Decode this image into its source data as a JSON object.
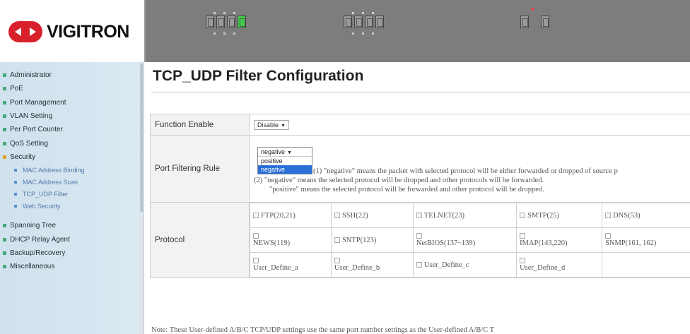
{
  "brand": {
    "name": "VIGITRON",
    "color": "#d8202a"
  },
  "sidebar": {
    "items": [
      {
        "label": "Administrator"
      },
      {
        "label": "PoE"
      },
      {
        "label": "Port Management"
      },
      {
        "label": "VLAN Setting"
      },
      {
        "label": "Per Port Counter"
      },
      {
        "label": "QoS Setting"
      },
      {
        "label": "Security",
        "active": true
      }
    ],
    "security_sub": [
      {
        "label": "MAC Address Binding"
      },
      {
        "label": "MAC Address Scan"
      },
      {
        "label": "TCP_UDP Filter"
      },
      {
        "label": "Web Security"
      }
    ],
    "items_after": [
      {
        "label": "Spanning Tree"
      },
      {
        "label": "DHCP Relay Agent"
      },
      {
        "label": "Backup/Recovery"
      },
      {
        "label": "Miscellaneous"
      }
    ]
  },
  "page": {
    "title": "TCP_UDP Filter Configuration",
    "function_enable": {
      "label": "Function Enable",
      "value": "Disable"
    },
    "port_filtering_rule": {
      "label": "Port Filtering Rule",
      "value": "negative",
      "options": [
        "positive",
        "negative"
      ],
      "desc_line1": "(1) \"negative\" means the packet with selected protocol will be either forwarded or dropped of source p",
      "desc_line2": "(2) \"negative\" means the selected protocol will be dropped and other protocols will be forwarded.",
      "desc_line3": "\"positive\" means the selected protocol will be forwarded and other protocol will be dropped."
    },
    "protocol": {
      "label": "Protocol",
      "rows": [
        [
          "FTP(20,21)",
          "SSH(22)",
          "TELNET(23)",
          "SMTP(25)",
          "DNS(53)"
        ],
        [
          "NEWS(119)",
          "SNTP(123)",
          "NetBIOS(137~139)",
          "IMAP(143,220)",
          "SNMP(161, 162)"
        ],
        [
          "User_Define_a",
          "User_Define_b",
          "User_Define_c",
          "User_Define_d"
        ]
      ]
    },
    "note": "Note: These User-defined A/B/C TCP/UDP settings use the same port number settings as the User-defined A/B/C T"
  }
}
